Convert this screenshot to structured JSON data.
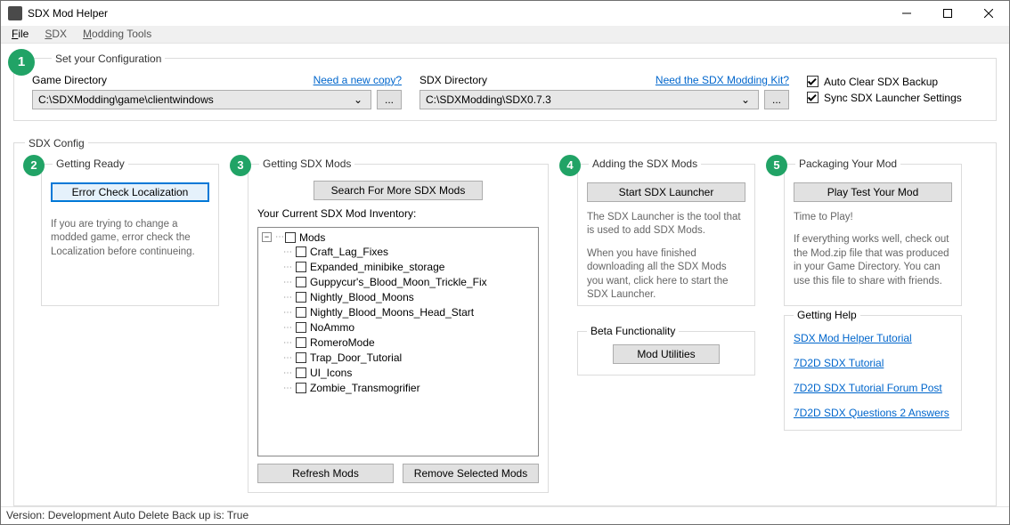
{
  "window": {
    "title": "SDX Mod Helper"
  },
  "menu": {
    "file": "File",
    "sdx": "SDX",
    "tools": "Modding Tools"
  },
  "config_header": {
    "legend": "Set your Configuration",
    "game_dir_label": "Game Directory",
    "game_dir_value": "C:\\SDXModding\\game\\clientwindows",
    "need_copy": "Need a new copy?",
    "sdx_dir_label": "SDX Directory",
    "sdx_dir_value": "C:\\SDXModding\\SDX0.7.3",
    "need_kit": "Need the SDX Modding Kit?",
    "browse": "...",
    "chk_autoclear": "Auto Clear SDX Backup",
    "chk_sync": "Sync SDX Launcher Settings"
  },
  "sdx_config_legend": "SDX Config",
  "step2": {
    "legend": "Getting Ready",
    "btn": "Error Check Localization",
    "help": "If you are trying to change a modded game, error check the Localization before continueing."
  },
  "step3": {
    "legend": "Getting SDX Mods",
    "search_btn": "Search For More SDX Mods",
    "inventory_label": "Your Current SDX Mod Inventory:",
    "root": "Mods",
    "mods": [
      "Craft_Lag_Fixes",
      "Expanded_minibike_storage",
      "Guppycur's_Blood_Moon_Trickle_Fix",
      "Nightly_Blood_Moons",
      "Nightly_Blood_Moons_Head_Start",
      "NoAmmo",
      "RomeroMode",
      "Trap_Door_Tutorial",
      "UI_Icons",
      "Zombie_Transmogrifier"
    ],
    "refresh_btn": "Refresh Mods",
    "remove_btn": "Remove Selected Mods"
  },
  "step4": {
    "legend": "Adding the SDX Mods",
    "btn": "Start SDX Launcher",
    "help1": "The SDX Launcher is the tool that is used to add SDX Mods.",
    "help2": "When you have finished downloading all the SDX Mods you want, click here to start the SDX Launcher."
  },
  "step5": {
    "legend": "Packaging Your Mod",
    "btn": "Play Test Your Mod",
    "help1": "Time to Play!",
    "help2": "If everything works well, check out the Mod.zip file that was produced in your Game Directory. You can use this file to share with friends."
  },
  "beta": {
    "legend": "Beta Functionality",
    "btn": "Mod Utilities"
  },
  "help": {
    "legend": "Getting Help",
    "links": [
      "SDX Mod Helper Tutorial",
      "7D2D SDX Tutorial",
      "7D2D SDX Tutorial Forum Post",
      "7D2D SDX Questions 2 Answers"
    ]
  },
  "status": "Version: Development  Auto Delete Back up is: True"
}
